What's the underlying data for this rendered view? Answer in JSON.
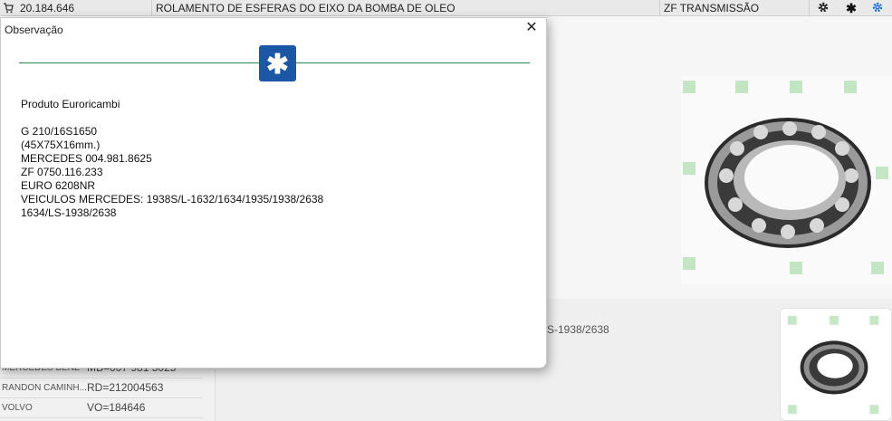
{
  "header": {
    "code": "20.184.646",
    "description": "ROLAMENTO DE ESFERAS DO EIXO DA BOMBA DE OLEO",
    "category": "ZF TRANSMISSÃO"
  },
  "background": {
    "partial_text": "S-1938/2638",
    "references": [
      {
        "brand": "MERCEDES BENZ",
        "ref": "MB=007 981 5025"
      },
      {
        "brand": "RANDON CAMINH...",
        "ref": "RD=212004563"
      },
      {
        "brand": "VOLVO",
        "ref": "VO=184646"
      }
    ]
  },
  "modal": {
    "title": "Observação",
    "close_label": "✕",
    "lines": [
      "Produto Euroricambi",
      "",
      "G 210/16S1650",
      "(45X75X16mm.)",
      "MERCEDES 004.981.8625",
      "ZF 0750.116.233",
      "EURO 6208NR",
      "VEICULOS MERCEDES: 1938S/L-1632/1634/1935/1938/2638",
      "1634/LS-1938/2638"
    ]
  },
  "icons": {
    "cart": "cart-icon",
    "settings": "gear-icon",
    "asterisk": "asterisk-icon",
    "sync": "cog-blue-icon"
  },
  "colors": {
    "accent_blue": "#1b57a5",
    "rule_green": "#2a8a55"
  }
}
